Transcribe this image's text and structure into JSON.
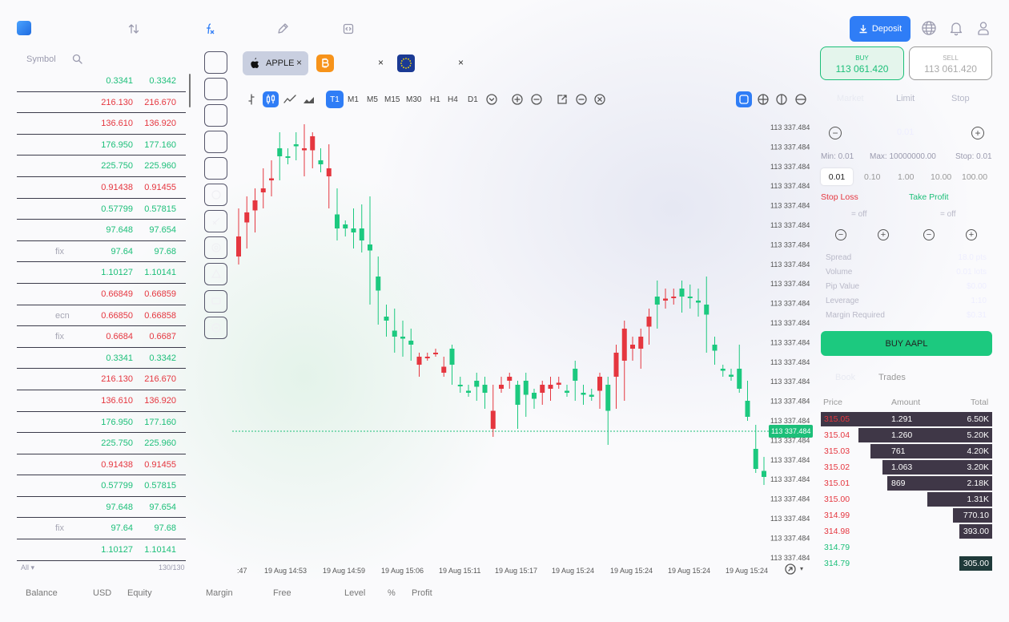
{
  "watchlist": {
    "header": "Symbol",
    "rows": [
      {
        "tag": "",
        "bid": "0.3341",
        "ask": "0.3342",
        "color": "g"
      },
      {
        "tag": "",
        "bid": "216.130",
        "ask": "216.670",
        "color": "r"
      },
      {
        "tag": "",
        "bid": "136.610",
        "ask": "136.920",
        "color": "r"
      },
      {
        "tag": "",
        "bid": "176.950",
        "ask": "177.160",
        "color": "g"
      },
      {
        "tag": "",
        "bid": "225.750",
        "ask": "225.960",
        "color": "g"
      },
      {
        "tag": "",
        "bid": "0.91438",
        "ask": "0.91455",
        "color": "r"
      },
      {
        "tag": "",
        "bid": "0.57799",
        "ask": "0.57815",
        "color": "g"
      },
      {
        "tag": "",
        "bid": "97.648",
        "ask": "97.654",
        "color": "g"
      },
      {
        "tag": "fix",
        "bid": "97.64",
        "ask": "97.68",
        "color": "g"
      },
      {
        "tag": "",
        "bid": "1.10127",
        "ask": "1.10141",
        "color": "g"
      },
      {
        "tag": "",
        "bid": "0.66849",
        "ask": "0.66859",
        "color": "r"
      },
      {
        "tag": "ecn",
        "bid": "0.66850",
        "ask": "0.66858",
        "color": "r"
      },
      {
        "tag": "fix",
        "bid": "0.6684",
        "ask": "0.6687",
        "color": "r"
      },
      {
        "tag": "",
        "bid": "0.3341",
        "ask": "0.3342",
        "color": "g"
      },
      {
        "tag": "",
        "bid": "216.130",
        "ask": "216.670",
        "color": "r"
      },
      {
        "tag": "",
        "bid": "136.610",
        "ask": "136.920",
        "color": "r"
      },
      {
        "tag": "",
        "bid": "176.950",
        "ask": "177.160",
        "color": "g"
      },
      {
        "tag": "",
        "bid": "225.750",
        "ask": "225.960",
        "color": "g"
      },
      {
        "tag": "",
        "bid": "0.91438",
        "ask": "0.91455",
        "color": "r"
      },
      {
        "tag": "",
        "bid": "0.57799",
        "ask": "0.57815",
        "color": "g"
      },
      {
        "tag": "",
        "bid": "97.648",
        "ask": "97.654",
        "color": "g"
      },
      {
        "tag": "fix",
        "bid": "97.64",
        "ask": "97.68",
        "color": "g"
      },
      {
        "tag": "",
        "bid": "1.10127",
        "ask": "1.10141",
        "color": "g"
      }
    ],
    "filter": "All ▾",
    "count": "130/130"
  },
  "nav": {
    "icons": [
      "sort-icon",
      "function-icon",
      "pencil-icon",
      "code-icon"
    ]
  },
  "header": {
    "deposit_label": "Deposit"
  },
  "tabs": [
    {
      "label": "APPLE",
      "close": "×"
    },
    {
      "label": "",
      "close": "×"
    },
    {
      "label": "",
      "close": "×"
    }
  ],
  "timeframes": [
    "T1",
    "M1",
    "M5",
    "M15",
    "M30",
    "H1",
    "H4",
    "D1"
  ],
  "active_timeframe": "T1",
  "chart_data": {
    "type": "candlestick",
    "y_tick_labels": [
      "113 337.484",
      "113 337.484",
      "113 337.484",
      "113 337.484",
      "113 337.484",
      "113 337.484",
      "113 337.484",
      "113 337.484",
      "113 337.484",
      "113 337.484",
      "113 337.484",
      "113 337.484",
      "113 337.484",
      "113 337.484",
      "113 337.484",
      "113 337.484",
      "113 337.484",
      "113 337.484",
      "113 337.484",
      "113 337.484",
      "113 337.484",
      "113 337.484",
      "113 337.484"
    ],
    "x_tick_labels": [
      ":47",
      "19 Aug 14:53",
      "19 Aug 14:59",
      "19 Aug 15:06",
      "19 Aug 15:11",
      "19 Aug 15:17",
      "19 Aug 15:24",
      "19 Aug 15:24",
      "19 Aug 15:24",
      "19 Aug 15:24"
    ],
    "last_price_label": "113 337.484",
    "candles": [
      [
        0,
        330,
        260,
        320,
        "r"
      ],
      [
        1,
        310,
        245,
        265,
        "r"
      ],
      [
        2,
        290,
        235,
        250,
        "r"
      ],
      [
        3,
        260,
        210,
        240,
        "r"
      ],
      [
        4,
        245,
        200,
        225,
        "r"
      ],
      [
        5,
        225,
        165,
        185,
        "g"
      ],
      [
        6,
        205,
        185,
        195,
        "g"
      ],
      [
        7,
        200,
        165,
        180,
        "g"
      ],
      [
        8,
        220,
        155,
        185,
        "r"
      ],
      [
        9,
        210,
        165,
        170,
        "r"
      ],
      [
        10,
        215,
        185,
        205,
        "g"
      ],
      [
        11,
        260,
        180,
        210,
        "r"
      ],
      [
        12,
        300,
        235,
        285,
        "g"
      ],
      [
        13,
        295,
        275,
        280,
        "g"
      ],
      [
        14,
        310,
        260,
        290,
        "g"
      ],
      [
        15,
        315,
        255,
        300,
        "g"
      ],
      [
        16,
        380,
        245,
        305,
        "g"
      ],
      [
        17,
        405,
        320,
        345,
        "g"
      ],
      [
        18,
        420,
        380,
        395,
        "g"
      ],
      [
        19,
        440,
        385,
        420,
        "g"
      ],
      [
        20,
        445,
        400,
        420,
        "g"
      ],
      [
        21,
        450,
        410,
        425,
        "g"
      ],
      [
        22,
        470,
        440,
        445,
        "r"
      ],
      [
        23,
        450,
        440,
        445,
        "r"
      ],
      [
        24,
        445,
        435,
        440,
        "r"
      ],
      [
        25,
        470,
        445,
        465,
        "r"
      ],
      [
        26,
        480,
        430,
        435,
        "g"
      ],
      [
        27,
        490,
        470,
        480,
        "g"
      ],
      [
        28,
        495,
        480,
        490,
        "g"
      ],
      [
        29,
        500,
        465,
        475,
        "g"
      ],
      [
        30,
        510,
        470,
        480,
        "g"
      ],
      [
        31,
        545,
        480,
        535,
        "r"
      ],
      [
        32,
        490,
        470,
        485,
        "r"
      ],
      [
        33,
        485,
        465,
        470,
        "r"
      ],
      [
        34,
        535,
        475,
        480,
        "g"
      ],
      [
        35,
        520,
        465,
        475,
        "g"
      ],
      [
        36,
        510,
        485,
        490,
        "g"
      ],
      [
        37,
        505,
        475,
        480,
        "r"
      ],
      [
        38,
        500,
        470,
        480,
        "r"
      ],
      [
        39,
        485,
        470,
        480,
        "r"
      ],
      [
        40,
        495,
        480,
        490,
        "g"
      ],
      [
        41,
        500,
        450,
        460,
        "g"
      ],
      [
        42,
        505,
        480,
        490,
        "g"
      ],
      [
        43,
        500,
        485,
        495,
        "g"
      ],
      [
        44,
        510,
        465,
        470,
        "r"
      ],
      [
        45,
        555,
        470,
        480,
        "g"
      ],
      [
        46,
        510,
        430,
        440,
        "r"
      ],
      [
        47,
        500,
        400,
        410,
        "r"
      ],
      [
        48,
        450,
        420,
        430,
        "r"
      ],
      [
        49,
        460,
        410,
        420,
        "r"
      ],
      [
        50,
        430,
        385,
        395,
        "r"
      ],
      [
        51,
        410,
        350,
        370,
        "g"
      ],
      [
        52,
        385,
        360,
        375,
        "r"
      ],
      [
        53,
        380,
        360,
        370,
        "r"
      ],
      [
        54,
        390,
        350,
        360,
        "g"
      ],
      [
        55,
        385,
        355,
        370,
        "g"
      ],
      [
        56,
        395,
        360,
        375,
        "g"
      ],
      [
        57,
        440,
        345,
        380,
        "g"
      ],
      [
        58,
        455,
        420,
        430,
        "g"
      ],
      [
        59,
        470,
        455,
        460,
        "g"
      ],
      [
        60,
        475,
        460,
        470,
        "g"
      ],
      [
        61,
        490,
        430,
        485,
        "g"
      ],
      [
        62,
        525,
        475,
        520,
        "g"
      ],
      [
        63,
        590,
        530,
        585,
        "g"
      ],
      [
        64,
        605,
        570,
        595,
        "g"
      ]
    ]
  },
  "status_bar": [
    {
      "label": "Balance",
      "value": ""
    },
    {
      "label": "USD",
      "value": ""
    },
    {
      "label": "Equity",
      "value": ""
    },
    {
      "label": "Margin",
      "value": ""
    },
    {
      "label": "Free",
      "value": ""
    },
    {
      "label": "Level",
      "value": ""
    },
    {
      "label": "%",
      "value": ""
    },
    {
      "label": "Profit",
      "value": ""
    }
  ],
  "trade": {
    "buy_label": "BUY",
    "buy_price": "113 061.420",
    "sell_label": "SELL",
    "sell_price": "113 061.420",
    "order_types": [
      "Market",
      "Limit",
      "Stop"
    ],
    "qty": "0.01",
    "min": "Min: 0.01",
    "max": "Max: 10000000.00",
    "stop": "Stop: 0.01",
    "presets": [
      "0.01",
      "0.10",
      "1.00",
      "10.00",
      "100.00"
    ],
    "stop_loss": "Stop Loss",
    "take_profit": "Take Profit",
    "sl_value": "= off",
    "tp_value": "= off",
    "stats": [
      {
        "label": "Spread",
        "value": "18.0 pts"
      },
      {
        "label": "Volume",
        "value": "0.01 lots"
      },
      {
        "label": "Pip Value",
        "value": "$0.00"
      },
      {
        "label": "Leverage",
        "value": "1:10"
      },
      {
        "label": "Margin Required",
        "value": "$0.31"
      }
    ],
    "buy_button": "BUY AAPL"
  },
  "orderbook": {
    "tabs": [
      "Book",
      "Trades"
    ],
    "headers": [
      "Price",
      "Amount",
      "Total"
    ],
    "rows": [
      {
        "price": "315.05",
        "amount": "1.291",
        "total": "6.50K",
        "pcolor": "r",
        "fill": 1.0
      },
      {
        "price": "315.04",
        "amount": "1.260",
        "total": "5.20K",
        "pcolor": "r",
        "fill": 0.78
      },
      {
        "price": "315.03",
        "amount": "761",
        "total": "4.20K",
        "pcolor": "r",
        "fill": 0.71
      },
      {
        "price": "315.02",
        "amount": "1.063",
        "total": "3.20K",
        "pcolor": "r",
        "fill": 0.64
      },
      {
        "price": "315.01",
        "amount": "869",
        "total": "2.18K",
        "pcolor": "r",
        "fill": 0.61
      },
      {
        "price": "315.00",
        "amount": "",
        "total": "1.31K",
        "pcolor": "r",
        "fill": 0.38
      },
      {
        "price": "314.99",
        "amount": "",
        "total": "770.10",
        "pcolor": "r",
        "fill": 0.23
      },
      {
        "price": "314.98",
        "amount": "",
        "total": "393.00",
        "pcolor": "r",
        "fill": 0.19
      },
      {
        "price": "314.79",
        "amount": "",
        "total": "",
        "pcolor": "g",
        "fill": 0
      },
      {
        "price": "314.79",
        "amount": "",
        "total": "305.00",
        "pcolor": "g",
        "fill": 0.19
      }
    ]
  }
}
